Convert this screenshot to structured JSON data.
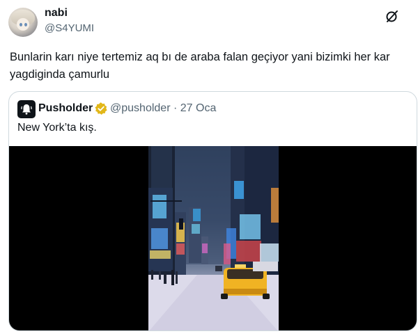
{
  "tweet": {
    "author_name": "nabi",
    "author_handle": "@S4YUMI",
    "text": "Bunlarin karı niye tertemiz aq bı de araba falan geçiyor yani bizimki her kar yagdiginda çamurlu"
  },
  "quoted": {
    "author_name": "Pusholder",
    "author_handle": "@pusholder",
    "separator": "·",
    "date": "27 Oca",
    "text": "New York’ta kış."
  },
  "icons": {
    "grok": "grok-icon",
    "verified": "verified-badge-icon",
    "quoted_avatar": "bell-icon"
  },
  "colors": {
    "verified_gold": "#e2b719",
    "secondary_text": "#536471",
    "border": "#cfd9de",
    "taxi_yellow": "#f0b323"
  }
}
